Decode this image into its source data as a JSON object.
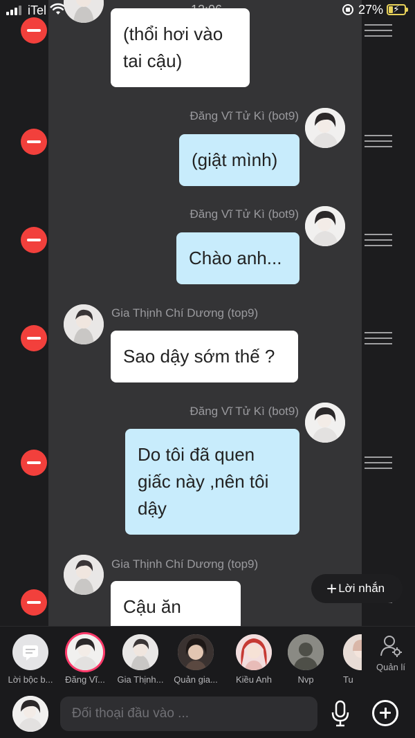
{
  "status": {
    "carrier": "iTel",
    "time": "12:06",
    "battery": "27%",
    "battery_level": 0.27
  },
  "messages": [
    {
      "side": "left",
      "sender": "",
      "text": "(thổi hơi vào tai cậu)",
      "color": "#ffffff"
    },
    {
      "side": "right",
      "sender": "Đăng Vĩ Tử Kì (bot9)",
      "text": "(giật mình)",
      "color": "#c8ecfc"
    },
    {
      "side": "right",
      "sender": "Đăng Vĩ Tử Kì (bot9)",
      "text": "Chào anh...",
      "color": "#c8ecfc"
    },
    {
      "side": "left",
      "sender": "Gia Thịnh Chí Dương (top9)",
      "text": "Sao dậy sớm thế ?",
      "color": "#ffffff"
    },
    {
      "side": "right",
      "sender": "Đăng Vĩ Tử Kì (bot9)",
      "text": "Do tôi đã quen giấc này ,nên tôi dậy",
      "color": "#c8ecfc"
    },
    {
      "side": "left",
      "sender": "Gia Thịnh Chí Dương (top9)",
      "text": "Cậu ăn",
      "color": "#ffffff"
    }
  ],
  "fab": {
    "label": "Lời nhắn"
  },
  "characters": [
    {
      "name": "Lời bộc b...",
      "icon": "comment-icon"
    },
    {
      "name": "Đăng Vĩ...",
      "selected": true
    },
    {
      "name": "Gia Thịnh..."
    },
    {
      "name": "Quản gia..."
    },
    {
      "name": "Kiều Anh"
    },
    {
      "name": "Nvp"
    },
    {
      "name": "Tu"
    }
  ],
  "manage": {
    "label": "Quản lí",
    "icon": "person-gear-icon"
  },
  "input": {
    "placeholder": "Đối thoại đầu vào ...",
    "mic_icon": "mic-icon",
    "add_icon": "plus-circle-icon"
  },
  "colors": {
    "delete": "#f2403c",
    "selected_ring": "#ff3a6a",
    "right_bubble": "#c8ecfc",
    "left_bubble": "#ffffff"
  }
}
